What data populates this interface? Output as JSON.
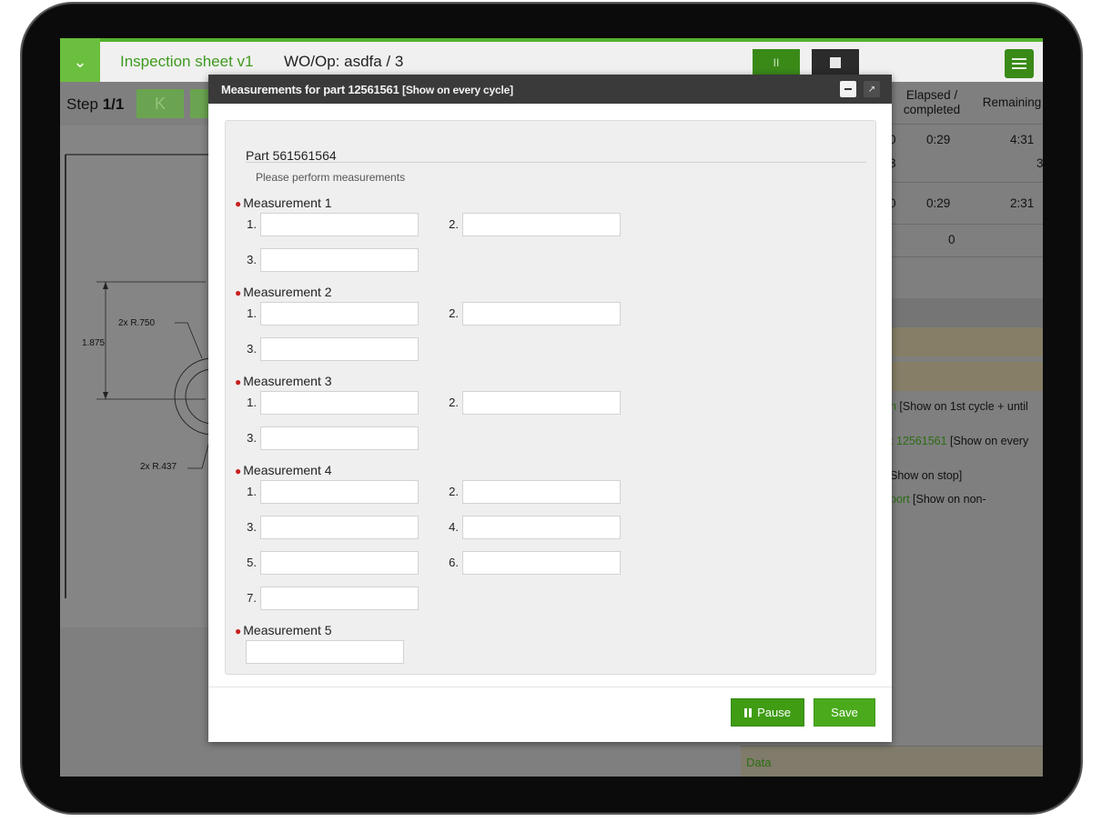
{
  "colors": {
    "brand_green": "#54b22f",
    "required_bullet": "#c8201f",
    "dialog_header": "#3a3a3a"
  },
  "app": {
    "title": "Inspection sheet v1",
    "wo_op": "WO/Op: asdfa / 3",
    "step_prefix": "Step ",
    "step_value": "1/1",
    "first_step_glyph": "K",
    "toggle_glyph": "⌄",
    "pause_glyph": "II"
  },
  "drawing": {
    "dims": [
      "2x R.750",
      "1.875",
      "2x R.437"
    ]
  },
  "right_table": {
    "headers": [
      "Elapsed / completed",
      "Remaining"
    ],
    "rows": [
      {
        "cut": "0",
        "elapsed": "0:29",
        "remaining": "4:31"
      },
      {
        "cut": "3",
        "elapsed": "",
        "remaining": "3"
      },
      {
        "cut": "0",
        "elapsed": "0:29",
        "remaining": "2:31"
      },
      {
        "cut": "",
        "elapsed": "0",
        "remaining": ""
      }
    ],
    "links": [
      {
        "green": "n",
        "rest": " [Show on 1st cycle + until"
      },
      {
        "green": "t 12561561",
        "rest": " [Show on every"
      },
      {
        "green": "",
        "rest": "Show on stop]"
      },
      {
        "green": "port",
        "rest": " [Show on non-"
      }
    ],
    "data_label": "Data"
  },
  "dialog": {
    "title": "Measurements for part 12561561",
    "title_note": "[Show on every cycle]",
    "popout_glyph": "↗",
    "part_title": "Part 561561564",
    "hint": "Please perform measurements",
    "measurements": [
      {
        "label": "Measurement 1",
        "fields": [
          "1.",
          "2.",
          "3."
        ]
      },
      {
        "label": "Measurement 2",
        "fields": [
          "1.",
          "2.",
          "3."
        ]
      },
      {
        "label": "Measurement 3",
        "fields": [
          "1.",
          "2.",
          "3."
        ]
      },
      {
        "label": "Measurement 4",
        "fields": [
          "1.",
          "2.",
          "3.",
          "4.",
          "5.",
          "6.",
          "7."
        ]
      },
      {
        "label": "Measurement 5",
        "fields": []
      }
    ],
    "measurement5_value": "",
    "pause_label": "Pause",
    "save_label": "Save"
  }
}
